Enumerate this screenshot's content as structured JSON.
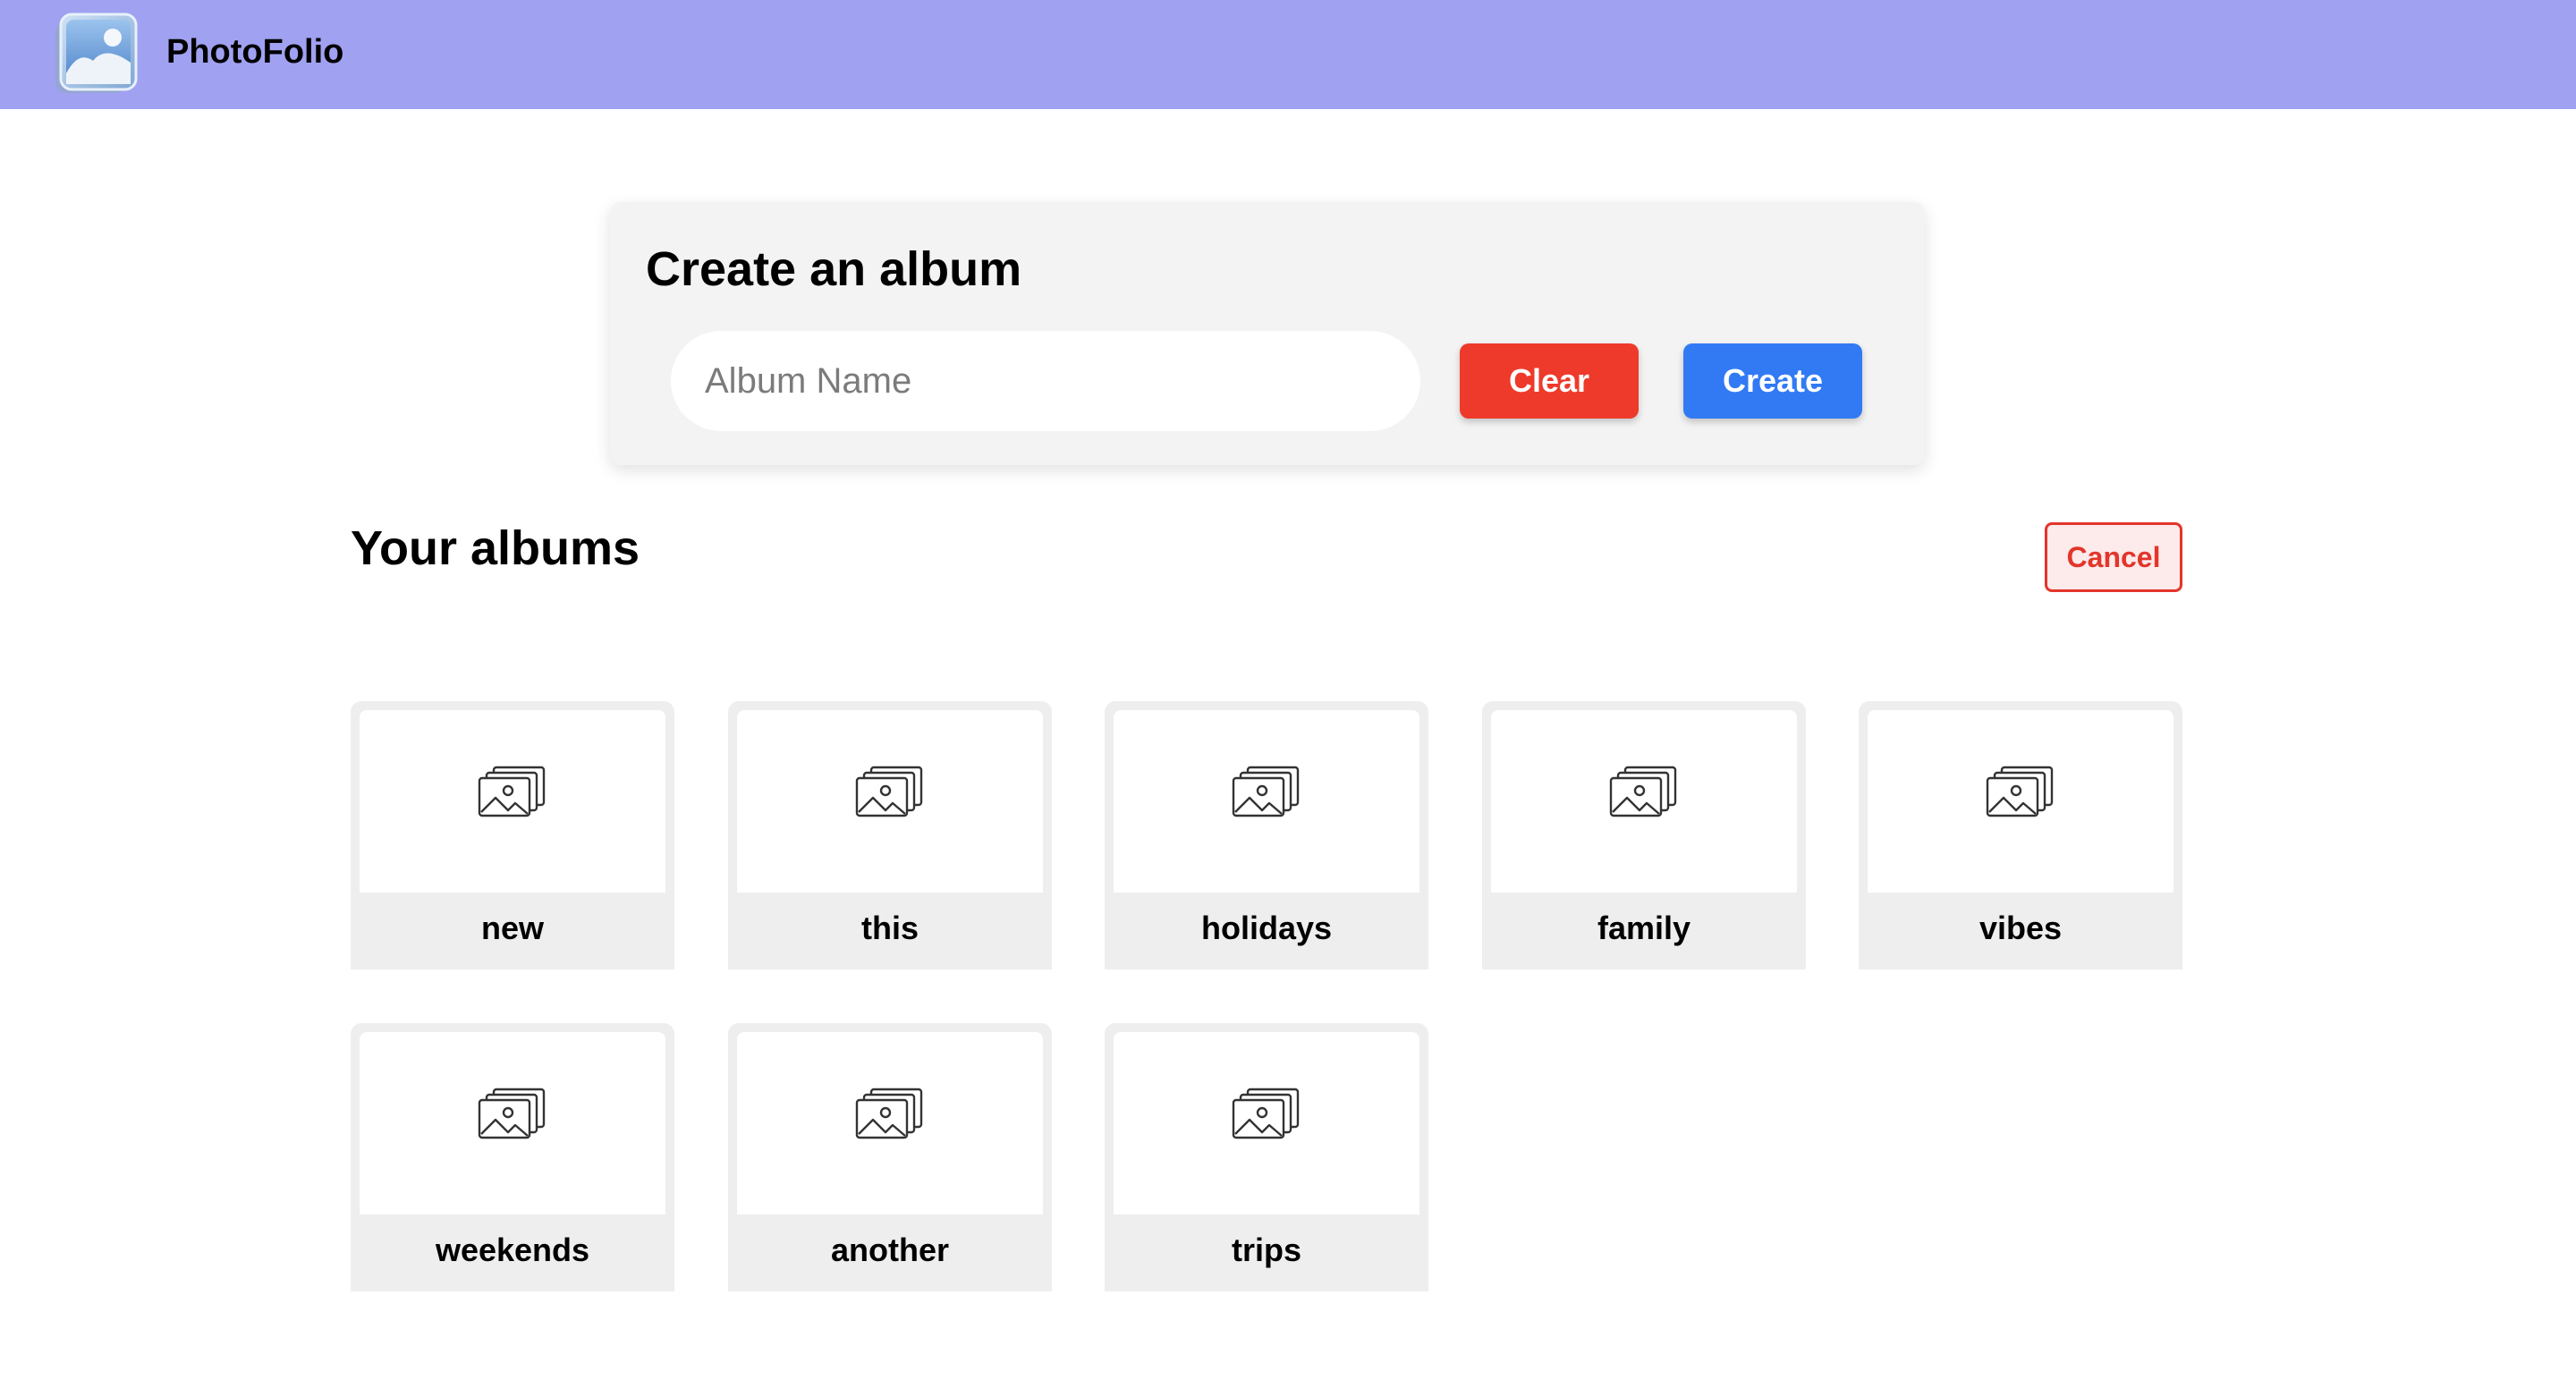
{
  "navbar": {
    "brand": "PhotoFolio",
    "logo_icon": "photo-stack-logo-icon"
  },
  "create_form": {
    "title": "Create an album",
    "input_placeholder": "Album Name",
    "input_value": "",
    "clear_label": "Clear",
    "create_label": "Create"
  },
  "albums_section": {
    "title": "Your albums",
    "cancel_label": "Cancel",
    "album_icon": "images-stack-icon",
    "albums": [
      {
        "name": "new"
      },
      {
        "name": "this"
      },
      {
        "name": "holidays"
      },
      {
        "name": "family"
      },
      {
        "name": "vibes"
      },
      {
        "name": "weekends"
      },
      {
        "name": "another"
      },
      {
        "name": "trips"
      }
    ]
  },
  "colors": {
    "navbar": "#a0a1f1",
    "clear": "#ee3a2a",
    "create": "#317af4",
    "cancel": "#e3352a",
    "card_bg": "#f3f3f3"
  }
}
